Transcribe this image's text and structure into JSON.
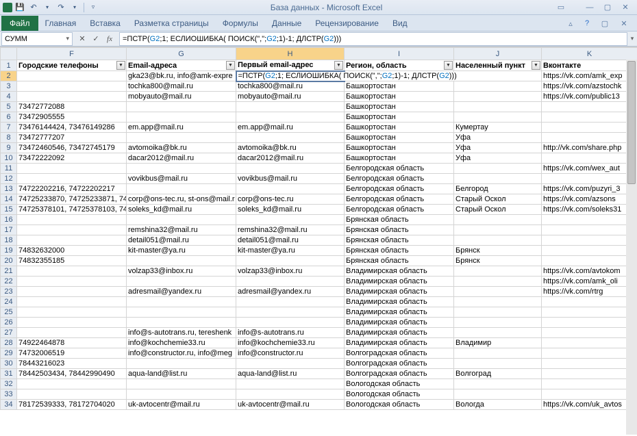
{
  "title": "База данных  -  Microsoft Excel",
  "ribbon": {
    "file": "Файл",
    "tabs": [
      "Главная",
      "Вставка",
      "Разметка страницы",
      "Формулы",
      "Данные",
      "Рецензирование",
      "Вид"
    ]
  },
  "namebox": "СУММ",
  "formula_parts": {
    "p1": "=ПСТР(",
    "g2a": "G2",
    "p2": ";1; ЕСЛИОШИБКА( ПОИСК(\",\";",
    "g2b": "G2",
    "p3": ";1)-1; ДЛСТР(",
    "g2c": "G2",
    "p4": ")))"
  },
  "columns": [
    "F",
    "G",
    "H",
    "I",
    "J",
    "K"
  ],
  "headers": {
    "F": "Городские телефоны",
    "G": "Email-адреса",
    "H": "Первый email-адрес",
    "I": "Регион, область",
    "J": "Населенный пункт",
    "K": "Вконтакте"
  },
  "edit_parts": {
    "p1": "=ПСТР(",
    "g2a": "G2",
    "p2": ";1; ЕСЛИОШИБКА( ПОИСК(\",\";",
    "g2b": "G2",
    "p3": ";1)-1; ДЛСТР(",
    "g2c": "G2",
    "p4": ")))"
  },
  "rows": [
    {
      "n": 2,
      "F": "",
      "G": "gka23@bk.ru, info@amk-expre",
      "H": "__EDIT__",
      "I": "",
      "J": "",
      "K": "https://vk.com/amk_exp"
    },
    {
      "n": 3,
      "F": "",
      "G": "tochka800@mail.ru",
      "H": "tochka800@mail.ru",
      "I": "Башкортостан",
      "J": "",
      "K": "https://vk.com/azstochk"
    },
    {
      "n": 4,
      "F": "",
      "G": "mobyauto@mail.ru",
      "H": "mobyauto@mail.ru",
      "I": "Башкортостан",
      "J": "",
      "K": "https://vk.com/public13"
    },
    {
      "n": 5,
      "F": "73472772088",
      "G": "",
      "H": "",
      "I": "Башкортостан",
      "J": "",
      "K": ""
    },
    {
      "n": 6,
      "F": "73472905555",
      "G": "",
      "H": "",
      "I": "Башкортостан",
      "J": "",
      "K": ""
    },
    {
      "n": 7,
      "F": "73476144424, 73476149286",
      "G": "em.app@mail.ru",
      "H": "em.app@mail.ru",
      "I": "Башкортостан",
      "J": "Кумертау",
      "K": ""
    },
    {
      "n": 8,
      "F": "73472777207",
      "G": "",
      "H": "",
      "I": "Башкортостан",
      "J": "Уфа",
      "K": ""
    },
    {
      "n": 9,
      "F": "73472460546, 73472745179",
      "G": "avtomoika@bk.ru",
      "H": "avtomoika@bk.ru",
      "I": "Башкортостан",
      "J": "Уфа",
      "K": "http://vk.com/share.php"
    },
    {
      "n": 10,
      "F": "73472222092",
      "G": "dacar2012@mail.ru",
      "H": "dacar2012@mail.ru",
      "I": "Башкортостан",
      "J": "Уфа",
      "K": ""
    },
    {
      "n": 11,
      "F": "",
      "G": "",
      "H": "",
      "I": "Белгородская область",
      "J": "",
      "K": "https://vk.com/wex_aut"
    },
    {
      "n": 12,
      "F": "",
      "G": "vovikbus@mail.ru",
      "H": "vovikbus@mail.ru",
      "I": "Белгородская область",
      "J": "",
      "K": ""
    },
    {
      "n": 13,
      "F": "74722202216, 74722202217",
      "G": "",
      "H": "",
      "I": "Белгородская область",
      "J": "Белгород",
      "K": "https://vk.com/puzyri_3"
    },
    {
      "n": 14,
      "F": "74725233870, 74725233871, 7472",
      "G": "corp@ons-tec.ru, st-ons@mail.r",
      "H": "corp@ons-tec.ru",
      "I": "Белгородская область",
      "J": "Старый Оскол",
      "K": "https://vk.com/azsons"
    },
    {
      "n": 15,
      "F": "74725378101, 74725378103, 7472",
      "G": "soleks_kd@mail.ru",
      "H": "soleks_kd@mail.ru",
      "I": "Белгородская область",
      "J": "Старый Оскол",
      "K": "https://vk.com/soleks31"
    },
    {
      "n": 16,
      "F": "",
      "G": "",
      "H": "",
      "I": "Брянская область",
      "J": "",
      "K": ""
    },
    {
      "n": 17,
      "F": "",
      "G": "remshina32@mail.ru",
      "H": "remshina32@mail.ru",
      "I": "Брянская область",
      "J": "",
      "K": ""
    },
    {
      "n": 18,
      "F": "",
      "G": "detail051@mail.ru",
      "H": "detail051@mail.ru",
      "I": "Брянская область",
      "J": "",
      "K": ""
    },
    {
      "n": 19,
      "F": "74832632000",
      "G": "kit-master@ya.ru",
      "H": "kit-master@ya.ru",
      "I": "Брянская область",
      "J": "Брянск",
      "K": ""
    },
    {
      "n": 20,
      "F": "74832355185",
      "G": "",
      "H": "",
      "I": "Брянская область",
      "J": "Брянск",
      "K": ""
    },
    {
      "n": 21,
      "F": "",
      "G": "volzap33@inbox.ru",
      "H": "volzap33@inbox.ru",
      "I": "Владимирская область",
      "J": "",
      "K": "https://vk.com/avtokom"
    },
    {
      "n": 22,
      "F": "",
      "G": "",
      "H": "",
      "I": "Владимирская область",
      "J": "",
      "K": "https://vk.com/amk_oli"
    },
    {
      "n": 23,
      "F": "",
      "G": "adresmail@yandex.ru",
      "H": "adresmail@yandex.ru",
      "I": "Владимирская область",
      "J": "",
      "K": "https://vk.com/rtrg"
    },
    {
      "n": 24,
      "F": "",
      "G": "",
      "H": "",
      "I": "Владимирская область",
      "J": "",
      "K": ""
    },
    {
      "n": 25,
      "F": "",
      "G": "",
      "H": "",
      "I": "Владимирская область",
      "J": "",
      "K": ""
    },
    {
      "n": 26,
      "F": "",
      "G": "",
      "H": "",
      "I": "Владимирская область",
      "J": "",
      "K": ""
    },
    {
      "n": 27,
      "F": "",
      "G": "info@s-autotrans.ru, tereshenk",
      "H": "info@s-autotrans.ru",
      "I": "Владимирская область",
      "J": "",
      "K": ""
    },
    {
      "n": 28,
      "F": "74922464878",
      "G": "info@kochchemie33.ru",
      "H": "info@kochchemie33.ru",
      "I": "Владимирская область",
      "J": "Владимир",
      "K": ""
    },
    {
      "n": 29,
      "F": "74732006519",
      "G": "info@constructor.ru, info@meg",
      "H": "info@constructor.ru",
      "I": "Волгоградская область",
      "J": "",
      "K": ""
    },
    {
      "n": 30,
      "F": "78443216023",
      "G": "",
      "H": "",
      "I": "Волгоградская область",
      "J": "",
      "K": ""
    },
    {
      "n": 31,
      "F": "78442503434, 78442990490",
      "G": "aqua-land@list.ru",
      "H": "aqua-land@list.ru",
      "I": "Волгоградская область",
      "J": "Волгоград",
      "K": ""
    },
    {
      "n": 32,
      "F": "",
      "G": "",
      "H": "",
      "I": "Вологодская область",
      "J": "",
      "K": ""
    },
    {
      "n": 33,
      "F": "",
      "G": "",
      "H": "",
      "I": "Вологодская область",
      "J": "",
      "K": ""
    },
    {
      "n": 34,
      "F": "78172539333, 78172704020",
      "G": "uk-avtocentr@mail.ru",
      "H": "uk-avtocentr@mail.ru",
      "I": "Вологодская область",
      "J": "Вологда",
      "K": "https://vk.com/uk_avtos"
    }
  ]
}
